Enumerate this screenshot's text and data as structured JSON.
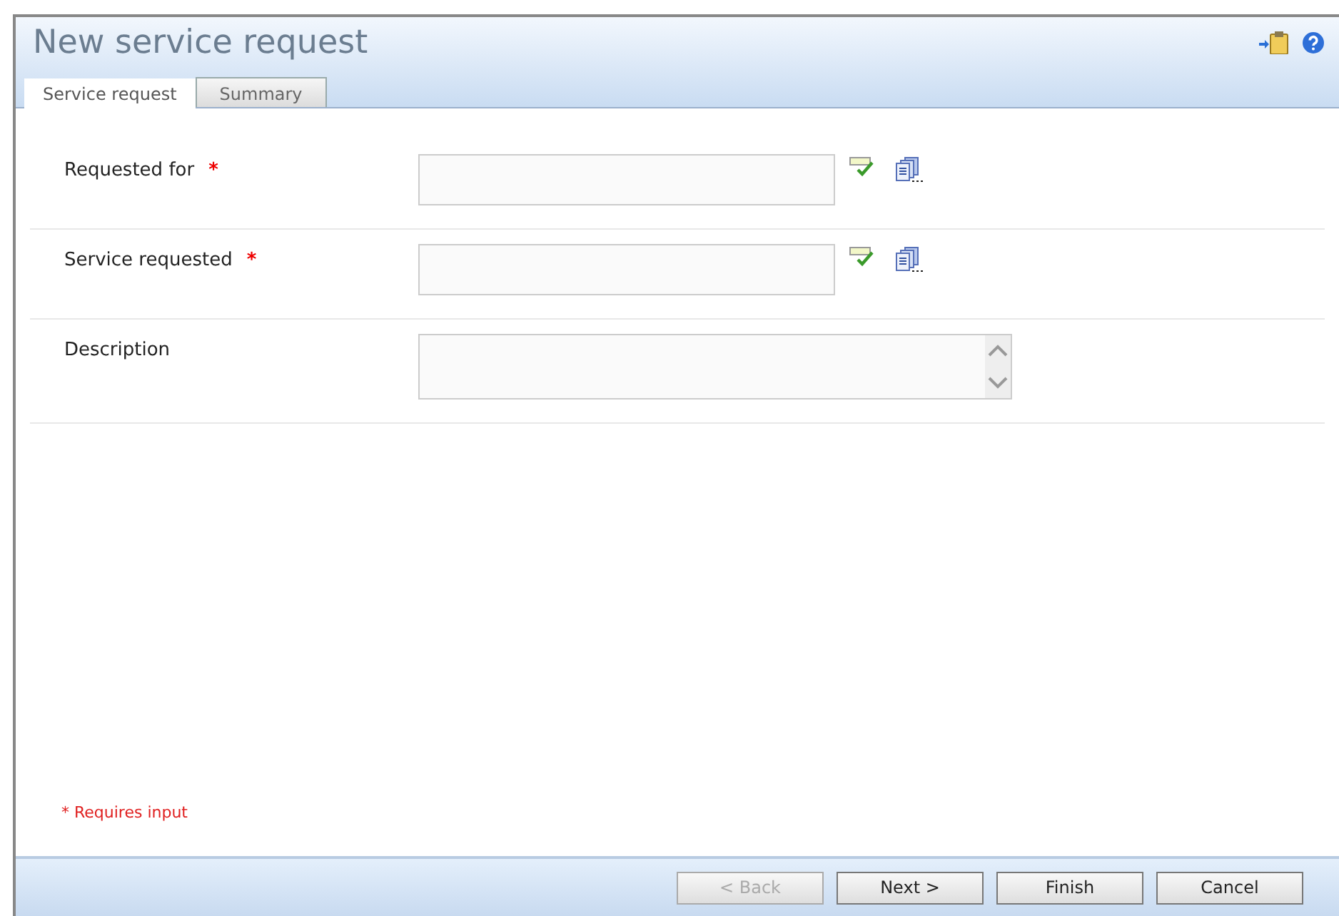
{
  "window": {
    "title": "New service request"
  },
  "tabs": [
    {
      "label": "Service request",
      "selected": true
    },
    {
      "label": "Summary",
      "selected": false
    }
  ],
  "fields": [
    {
      "label": "Requested for",
      "required": true,
      "kind": "lookup"
    },
    {
      "label": "Service requested",
      "required": true,
      "kind": "lookup"
    },
    {
      "label": "Description",
      "required": false,
      "kind": "multiline"
    }
  ],
  "required_note": "* Requires input",
  "required_mark": "*",
  "buttons": [
    {
      "label": "< Back",
      "disabled": true
    },
    {
      "label": "Next >",
      "disabled": false
    },
    {
      "label": "Finish",
      "disabled": false
    },
    {
      "label": "Cancel",
      "disabled": false
    }
  ]
}
